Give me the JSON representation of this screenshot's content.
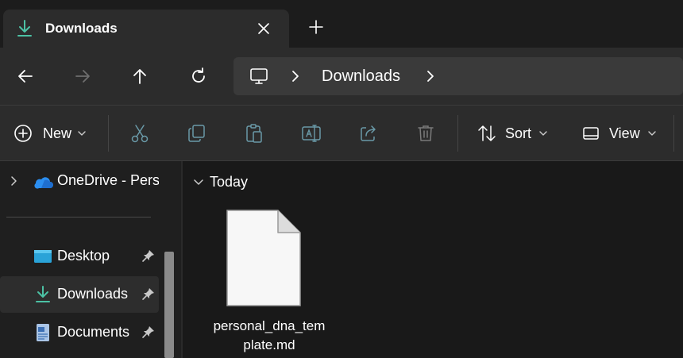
{
  "window": {
    "tab_title": "Downloads",
    "tab_icon": "download-icon",
    "close_tab_icon": "close-icon",
    "new_tab_icon": "plus-icon"
  },
  "nav": {
    "back_icon": "arrow-left-icon",
    "forward_icon": "arrow-right-icon",
    "up_icon": "arrow-up-icon",
    "refresh_icon": "refresh-icon",
    "breadcrumb_root_icon": "computer-icon",
    "breadcrumb": [
      "Downloads"
    ]
  },
  "toolbar": {
    "new_label": "New",
    "sort_label": "Sort",
    "view_label": "View",
    "icons": [
      "cut-icon",
      "copy-icon",
      "paste-icon",
      "rename-icon",
      "share-icon",
      "delete-icon"
    ]
  },
  "sidebar": {
    "items": [
      {
        "label": "OneDrive - Perso",
        "icon": "onedrive-icon"
      },
      {
        "label": "Desktop",
        "icon": "desktop-icon",
        "pinned": true
      },
      {
        "label": "Downloads",
        "icon": "download-icon",
        "pinned": true,
        "selected": true
      },
      {
        "label": "Documents",
        "icon": "documents-icon",
        "pinned": true
      }
    ]
  },
  "content": {
    "group_label": "Today",
    "files": [
      {
        "name": "personal_dna_template.md",
        "icon": "file-icon"
      }
    ]
  },
  "colors": {
    "accent": "#4cc2a5",
    "background": "#191919",
    "toolbar_bg": "#2c2c2c"
  }
}
